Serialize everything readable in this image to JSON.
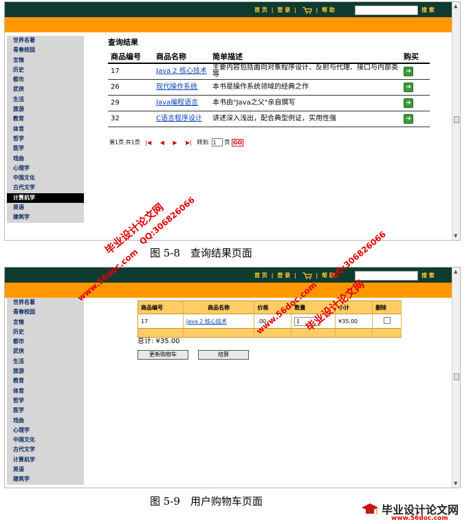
{
  "header": {
    "nav": [
      "首 页",
      "|",
      "登 录",
      "|",
      "帮 助"
    ],
    "search_placeholder": "",
    "search_label": "搜 索"
  },
  "sidebar": {
    "items": [
      "世界名著",
      "青春校园",
      "言情",
      "历史",
      "都市",
      "武侠",
      "生活",
      "旅游",
      "教育",
      "体育",
      "哲学",
      "医学",
      "戏曲",
      "心理学",
      "中国文化",
      "古代文学",
      "计算机学",
      "英语",
      "建筑学"
    ],
    "active_index_fig1": 16
  },
  "query_result": {
    "title": "查询结果",
    "columns": [
      "商品编号",
      "商品名称",
      "简单描述",
      "购买"
    ],
    "rows": [
      {
        "id": "17",
        "name": "Java 2 核心技术",
        "desc": "主要内容包括面向对象程序设计、反射与代理、接口与内部类等"
      },
      {
        "id": "26",
        "name": "现代操作系统",
        "desc": "本书是操作系统领域的经典之作"
      },
      {
        "id": "29",
        "name": "Java编程语言",
        "desc": "本书由\"Java之父\"亲自撰写"
      },
      {
        "id": "32",
        "name": "C语言程序设计",
        "desc": "讲述深入浅出，配合典型例证，实用性强"
      }
    ],
    "pager": {
      "page_text": "第1页 共1页",
      "goto_label": "转到:",
      "page_value": "1",
      "page_unit": "页",
      "go": "GO"
    }
  },
  "captions": {
    "fig1": "图 5-8　查询结果页面",
    "fig2": "图 5-9　用户购物车页面"
  },
  "cart": {
    "columns": [
      "商品编号",
      "商品名称",
      "价格",
      "数量",
      "小计",
      "删除"
    ],
    "rows": [
      {
        "id": "17",
        "name": "Java 2 核心技术",
        "price": ".00",
        "qty": "1",
        "subtotal": "¥35.00"
      }
    ],
    "total": "总计: ¥35.00",
    "update_button": "更新购物车",
    "checkout_button": "结算"
  },
  "watermarks": {
    "site": "www.56doc.com",
    "brand": "毕业设计论文网",
    "qq": "QQ:306826066"
  },
  "footer_logo": {
    "brand": "毕业设计论文网",
    "url": "www.56doc.com"
  },
  "colors": {
    "topbar": "#0f3b30",
    "orange": "#ff9800",
    "watermark": "#e20000"
  }
}
